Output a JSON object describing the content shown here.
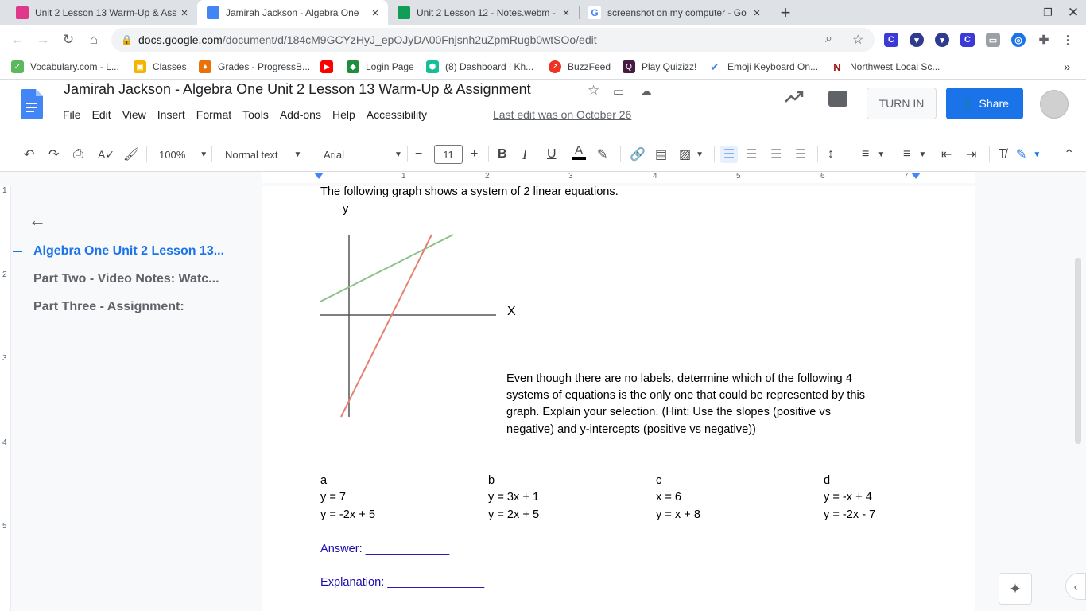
{
  "browser": {
    "tabs": [
      {
        "title": "Unit 2 Lesson 13 Warm-Up & Ass",
        "icon": "classroom-icon",
        "color": "#e0398c"
      },
      {
        "title": "Jamirah Jackson - Algebra One",
        "icon": "docs-icon",
        "color": "#4285f4"
      },
      {
        "title": "Unit 2 Lesson 12 - Notes.webm -",
        "icon": "drive-icon",
        "color": "#0f9d58"
      },
      {
        "title": "screenshot on my computer - Go",
        "icon": "google-icon",
        "color": "#ea4335"
      }
    ],
    "close_glyph": "×",
    "newtab_glyph": "+",
    "url_host": "docs.google.com",
    "url_path": "/document/d/184cM9GCYzHyJ_epOJyDA00Fnjsnh2uZpmRugb0wtSOo/edit",
    "bookmarks": [
      {
        "label": "Vocabulary.com - L...",
        "color": "#5cb85c"
      },
      {
        "label": "Classes",
        "color": "#f4b400"
      },
      {
        "label": "Grades - ProgressB...",
        "color": "#e8710a"
      },
      {
        "label": "",
        "color": "#ff0000"
      },
      {
        "label": "Login Page",
        "color": "#1e8e3e"
      },
      {
        "label": "(8) Dashboard | Kh...",
        "color": "#14bf96"
      },
      {
        "label": "BuzzFeed",
        "color": "#ee3322"
      },
      {
        "label": "Play Quizizz!",
        "color": "#461a42"
      },
      {
        "label": "Emoji Keyboard On...",
        "color": "#4285f4"
      },
      {
        "label": "Northwest Local Sc...",
        "color": "#a50e0e"
      }
    ],
    "bookmarks_more": "»"
  },
  "docs": {
    "title": "Jamirah Jackson - Algebra One Unit 2 Lesson 13 Warm-Up & Assignment",
    "menu": [
      "File",
      "Edit",
      "View",
      "Insert",
      "Format",
      "Tools",
      "Add-ons",
      "Help",
      "Accessibility"
    ],
    "last_edit": "Last edit was on October 26",
    "turn_in": "TURN IN",
    "share": "Share",
    "zoom": "100%",
    "style": "Normal text",
    "font": "Arial",
    "font_size": "11",
    "ruler_numbers": [
      "1",
      "2",
      "3",
      "4",
      "5",
      "6",
      "7"
    ],
    "vruler_numbers": [
      "1",
      "2",
      "3",
      "4",
      "5"
    ]
  },
  "outline": {
    "items": [
      "Algebra One Unit 2 Lesson 13...",
      "Part Two - Video Notes: Watc...",
      "Part Three - Assignment:"
    ]
  },
  "content": {
    "intro": "The following graph shows a system of 2 linear equations.",
    "y_label": "y",
    "x_label": "X",
    "prompt_lines": [
      "Even though there are no labels, determine which of the following 4",
      "systems of equations is the only one that could be represented by this",
      "graph.  Explain your selection. (Hint:  Use the slopes (positive vs",
      "negative) and y-intercepts (positive vs negative))"
    ],
    "options": [
      {
        "letter": "a",
        "eq1": "y = 7",
        "eq2": "y = -2x + 5"
      },
      {
        "letter": "b",
        "eq1": "y = 3x + 1",
        "eq2": "y = 2x + 5"
      },
      {
        "letter": "c",
        "eq1": "x = 6",
        "eq2": "y = x + 8"
      },
      {
        "letter": "d",
        "eq1": "y = -x + 4",
        "eq2": "y = -2x - 7"
      }
    ],
    "answer_label": "Answer:  _____________",
    "explanation_label": "Explanation: _______________",
    "line_colors": {
      "green": "#8dc18a",
      "red": "#e4826f"
    }
  }
}
